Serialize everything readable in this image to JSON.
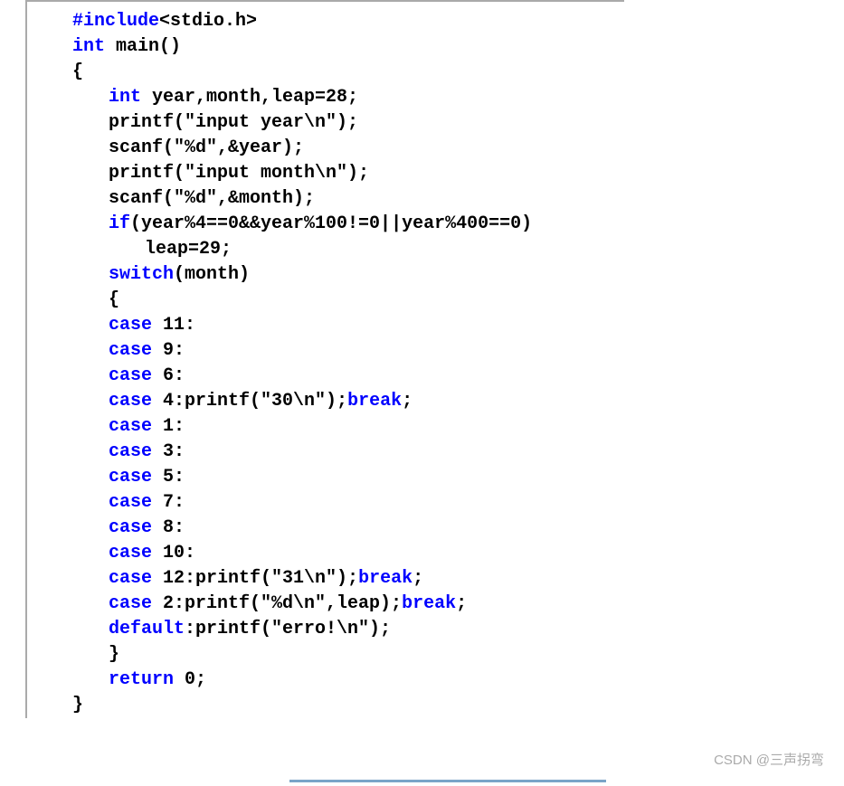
{
  "code": {
    "kw_include": "#include",
    "include_rest": "<stdio.h>",
    "kw_int1": "int",
    "main_rest": " main()",
    "brace_open": "{",
    "kw_int2": "int",
    "decl_rest": " year,month,leap=28;",
    "printf1": "printf(\"input year\\n\");",
    "scanf1": "scanf(\"%d\",&year);",
    "printf2": "printf(\"input month\\n\");",
    "scanf2": "scanf(\"%d\",&month);",
    "kw_if": "if",
    "if_cond": "(year%4==0&&year%100!=0||year%400==0)",
    "leap_assign": "leap=29;",
    "kw_switch": "switch",
    "switch_rest": "(month)",
    "brace_open2": "{",
    "kw_case": "case",
    "case11": " 11:",
    "case9": " 9:",
    "case6": " 6:",
    "case4_a": " 4:printf(\"30\\n\");",
    "kw_break": "break",
    "semi": ";",
    "case1": " 1:",
    "case3": " 3:",
    "case5": " 5:",
    "case7": " 7:",
    "case8": " 8:",
    "case10": " 10:",
    "case12_a": " 12:printf(\"31\\n\");",
    "case2_a": " 2:printf(\"%d\\n\",leap);",
    "kw_default": "default",
    "default_rest": ":printf(\"erro!\\n\");",
    "brace_close": "}",
    "kw_return": "return",
    "return_rest": " 0;",
    "brace_close2": "}"
  },
  "watermark": "CSDN @三声拐弯"
}
